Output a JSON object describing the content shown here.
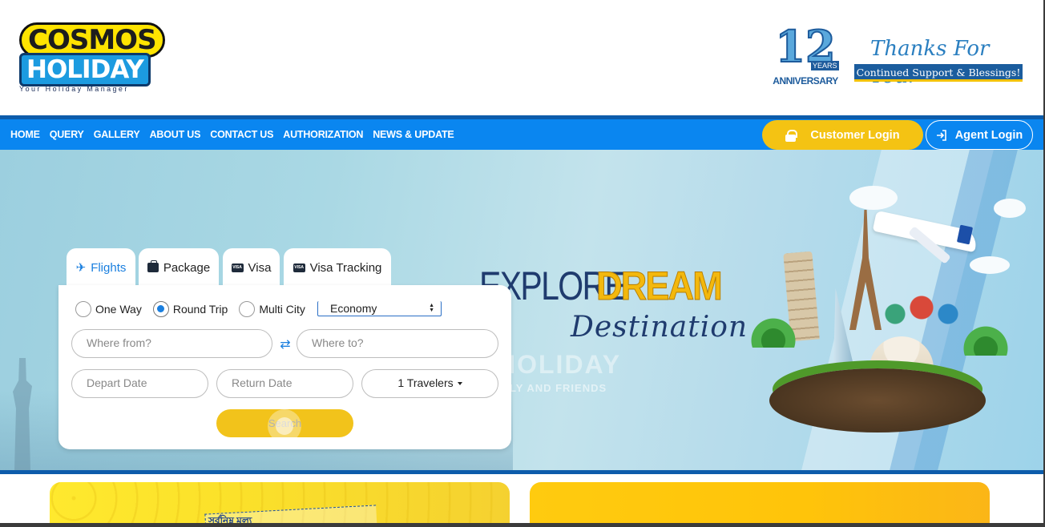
{
  "header": {
    "logo_line1": "COSMOS",
    "logo_line2": "HOLIDAY",
    "logo_tagline": "Your Holiday Manager",
    "anniversary_number": "12",
    "anniversary_years": "YEARS",
    "anniversary_label": "ANNIVERSARY",
    "thanks_script": "Thanks For Your",
    "thanks_bar": "Continued Support & Blessings!"
  },
  "nav": {
    "links": [
      "HOME",
      "QUERY",
      "GALLERY",
      "ABOUT US",
      "CONTACT US",
      "AUTHORIZATION",
      "NEWS & UPDATE"
    ],
    "customer_login": "Customer Login",
    "agent_login": "Agent Login"
  },
  "hero": {
    "explore": "EXPLORE",
    "dream": "DREAM",
    "destination": "Destination",
    "ghost_title": "HOLIDAY",
    "ghost_sub": "LY AND FRIENDS"
  },
  "search": {
    "tabs": [
      "Flights",
      "Package",
      "Visa",
      "Visa Tracking"
    ],
    "active_tab": "Flights",
    "trip_types": [
      "One Way",
      "Round Trip",
      "Multi City"
    ],
    "selected_trip": "Round Trip",
    "cabin_class": "Economy",
    "from_placeholder": "Where from?",
    "to_placeholder": "Where to?",
    "depart_placeholder": "Depart Date",
    "return_placeholder": "Return Date",
    "travelers": "1 Travelers",
    "search_label": "Search"
  },
  "cards": {
    "card1_text": "সর্বনিম্ন মূল্য"
  },
  "colors": {
    "nav_blue": "#0a86f0",
    "accent_yellow": "#f4c313",
    "active_blue": "#1a7fdf"
  }
}
